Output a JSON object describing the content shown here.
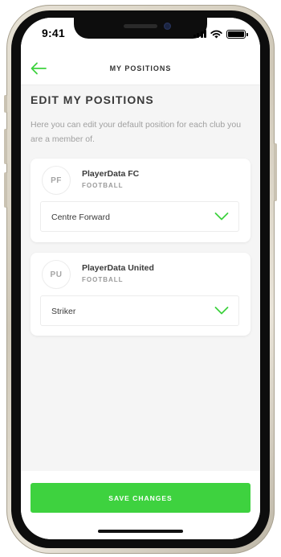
{
  "status_bar": {
    "time": "9:41"
  },
  "header": {
    "title": "MY POSITIONS",
    "back_icon": "arrow-left-icon"
  },
  "page": {
    "title": "EDIT MY POSITIONS",
    "description": "Here you can edit your default position for each club you are a member of."
  },
  "clubs": [
    {
      "initials": "PF",
      "name": "PlayerData FC",
      "sport": "FOOTBALL",
      "position": "Centre Forward"
    },
    {
      "initials": "PU",
      "name": "PlayerData United",
      "sport": "FOOTBALL",
      "position": "Striker"
    }
  ],
  "footer": {
    "save_label": "SAVE CHANGES"
  },
  "colors": {
    "accent": "#3ed23f",
    "background": "#f5f5f5",
    "text_primary": "#3a3a3a",
    "text_secondary": "#a0a0a0"
  }
}
